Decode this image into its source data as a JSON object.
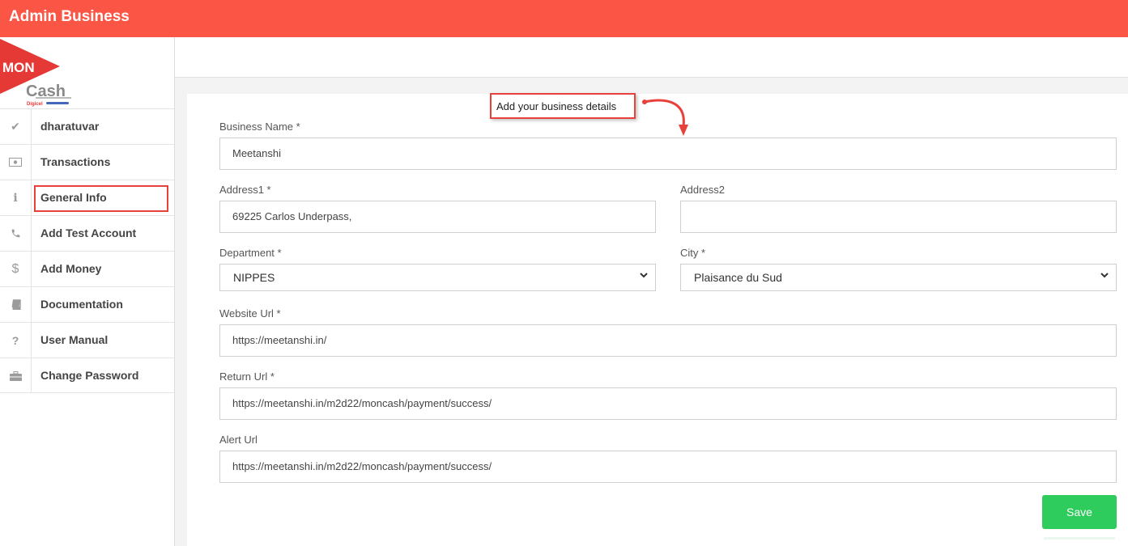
{
  "header": {
    "title": "Admin Business"
  },
  "logo": {
    "mon": "MON",
    "cash": "Cash",
    "digicel": "Digicel"
  },
  "sidebar": {
    "items": [
      {
        "label": "dharatuvar",
        "icon": "check-icon"
      },
      {
        "label": "Transactions",
        "icon": "money-icon"
      },
      {
        "label": "General Info",
        "icon": "info-icon"
      },
      {
        "label": "Add Test Account",
        "icon": "phone-icon"
      },
      {
        "label": "Add Money",
        "icon": "dollar-icon"
      },
      {
        "label": "Documentation",
        "icon": "book-icon"
      },
      {
        "label": "User Manual",
        "icon": "question-icon"
      },
      {
        "label": "Change Password",
        "icon": "briefcase-icon"
      }
    ]
  },
  "form": {
    "business_name": {
      "label": "Business Name *",
      "value": "Meetanshi"
    },
    "address1": {
      "label": "Address1 *",
      "value": "69225 Carlos Underpass,"
    },
    "address2": {
      "label": "Address2",
      "value": ""
    },
    "department": {
      "label": "Department *",
      "value": "NIPPES"
    },
    "city": {
      "label": "City *",
      "value": "Plaisance du Sud"
    },
    "website_url": {
      "label": "Website Url *",
      "value": "https://meetanshi.in/"
    },
    "return_url": {
      "label": "Return Url *",
      "value": "https://meetanshi.in/m2d22/moncash/payment/success/"
    },
    "alert_url": {
      "label": "Alert Url",
      "value": "https://meetanshi.in/m2d22/moncash/payment/success/"
    },
    "save_label": "Save"
  },
  "annotation": {
    "text": "Add your business details"
  },
  "colors": {
    "brand": "#fa5545",
    "save": "#2ecc5c",
    "annotation": "#e8413c"
  }
}
